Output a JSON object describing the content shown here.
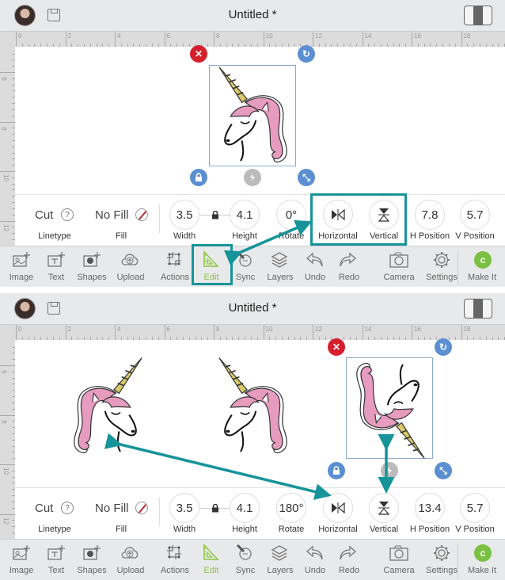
{
  "colors": {
    "accent_teal": "#17949a",
    "active_green": "#8cc63f",
    "makeit_green": "#7ac143",
    "delete_red": "#d5202c",
    "handle_blue": "#5b8fd1",
    "hair_pink": "#e79bbf",
    "horn_gold": "#d9c86a"
  },
  "ruler": {
    "horizontal_labels": [
      "0",
      "2",
      "4",
      "6",
      "8",
      "10",
      "12",
      "14",
      "16",
      "18"
    ],
    "vertical_labels": [
      "6",
      "8",
      "10",
      "12"
    ]
  },
  "panels": [
    {
      "header": {
        "title": "Untitled *",
        "avatar": "user-avatar",
        "save_icon": "save-icon",
        "view_toggle_icon": "view-toggle-icon"
      },
      "canvas": {
        "images": [
          {
            "name": "unicorn-head",
            "orientation": "original",
            "selected": true
          }
        ],
        "handles": {
          "delete": "✕",
          "rotate": "↻",
          "lock": "lock",
          "resize": "⤡",
          "flip": "flip"
        }
      },
      "properties": {
        "linetype": {
          "value": "Cut",
          "label": "Linetype",
          "help": "?"
        },
        "fill": {
          "value": "No Fill",
          "label": "Fill"
        },
        "width": {
          "value": "3.5",
          "label": "Width"
        },
        "height": {
          "value": "4.1",
          "label": "Height"
        },
        "rotate": {
          "value": "0°",
          "label": "Rotate"
        },
        "horizontal": {
          "label": "Horizontal"
        },
        "vertical": {
          "label": "Vertical"
        },
        "h_position": {
          "value": "7.8",
          "label": "H Position"
        },
        "v_position": {
          "value": "5.7",
          "label": "V Position"
        }
      },
      "highlighted": [
        "flip-group",
        "edit-tool"
      ]
    },
    {
      "header": {
        "title": "Untitled *",
        "avatar": "user-avatar",
        "save_icon": "save-icon",
        "view_toggle_icon": "view-toggle-icon"
      },
      "canvas": {
        "images": [
          {
            "name": "unicorn-head",
            "orientation": "flipped-horizontal",
            "selected": false
          },
          {
            "name": "unicorn-head",
            "orientation": "original",
            "selected": false
          },
          {
            "name": "unicorn-head",
            "orientation": "rotated-180",
            "selected": true
          }
        ],
        "handles": {
          "delete": "✕",
          "rotate": "↻",
          "lock": "lock",
          "resize": "⤡",
          "flip": "flip"
        }
      },
      "properties": {
        "linetype": {
          "value": "Cut",
          "label": "Linetype",
          "help": "?"
        },
        "fill": {
          "value": "No Fill",
          "label": "Fill"
        },
        "width": {
          "value": "3.5",
          "label": "Width"
        },
        "height": {
          "value": "4.1",
          "label": "Height"
        },
        "rotate": {
          "value": "180°",
          "label": "Rotate"
        },
        "horizontal": {
          "label": "Horizontal"
        },
        "vertical": {
          "label": "Vertical"
        },
        "h_position": {
          "value": "13.4",
          "label": "H Position"
        },
        "v_position": {
          "value": "5.7",
          "label": "V Position"
        }
      },
      "highlighted": []
    }
  ],
  "toolbar": {
    "items": [
      {
        "label": "Image",
        "icon": "image-add-icon"
      },
      {
        "label": "Text",
        "icon": "text-add-icon"
      },
      {
        "label": "Shapes",
        "icon": "shapes-add-icon"
      },
      {
        "label": "Upload",
        "icon": "upload-cloud-icon"
      },
      {
        "label": "Actions",
        "icon": "actions-icon"
      },
      {
        "label": "Edit",
        "icon": "edit-triangle-ruler-icon",
        "active": true
      },
      {
        "label": "Sync",
        "icon": "sync-icon"
      },
      {
        "label": "Layers",
        "icon": "layers-icon"
      },
      {
        "label": "Undo",
        "icon": "undo-icon"
      },
      {
        "label": "Redo",
        "icon": "redo-icon"
      },
      {
        "label": "Camera",
        "icon": "camera-icon"
      },
      {
        "label": "Settings",
        "icon": "settings-gear-icon"
      },
      {
        "label": "Make It",
        "icon": "make-it-icon",
        "glyph": "c"
      }
    ]
  }
}
